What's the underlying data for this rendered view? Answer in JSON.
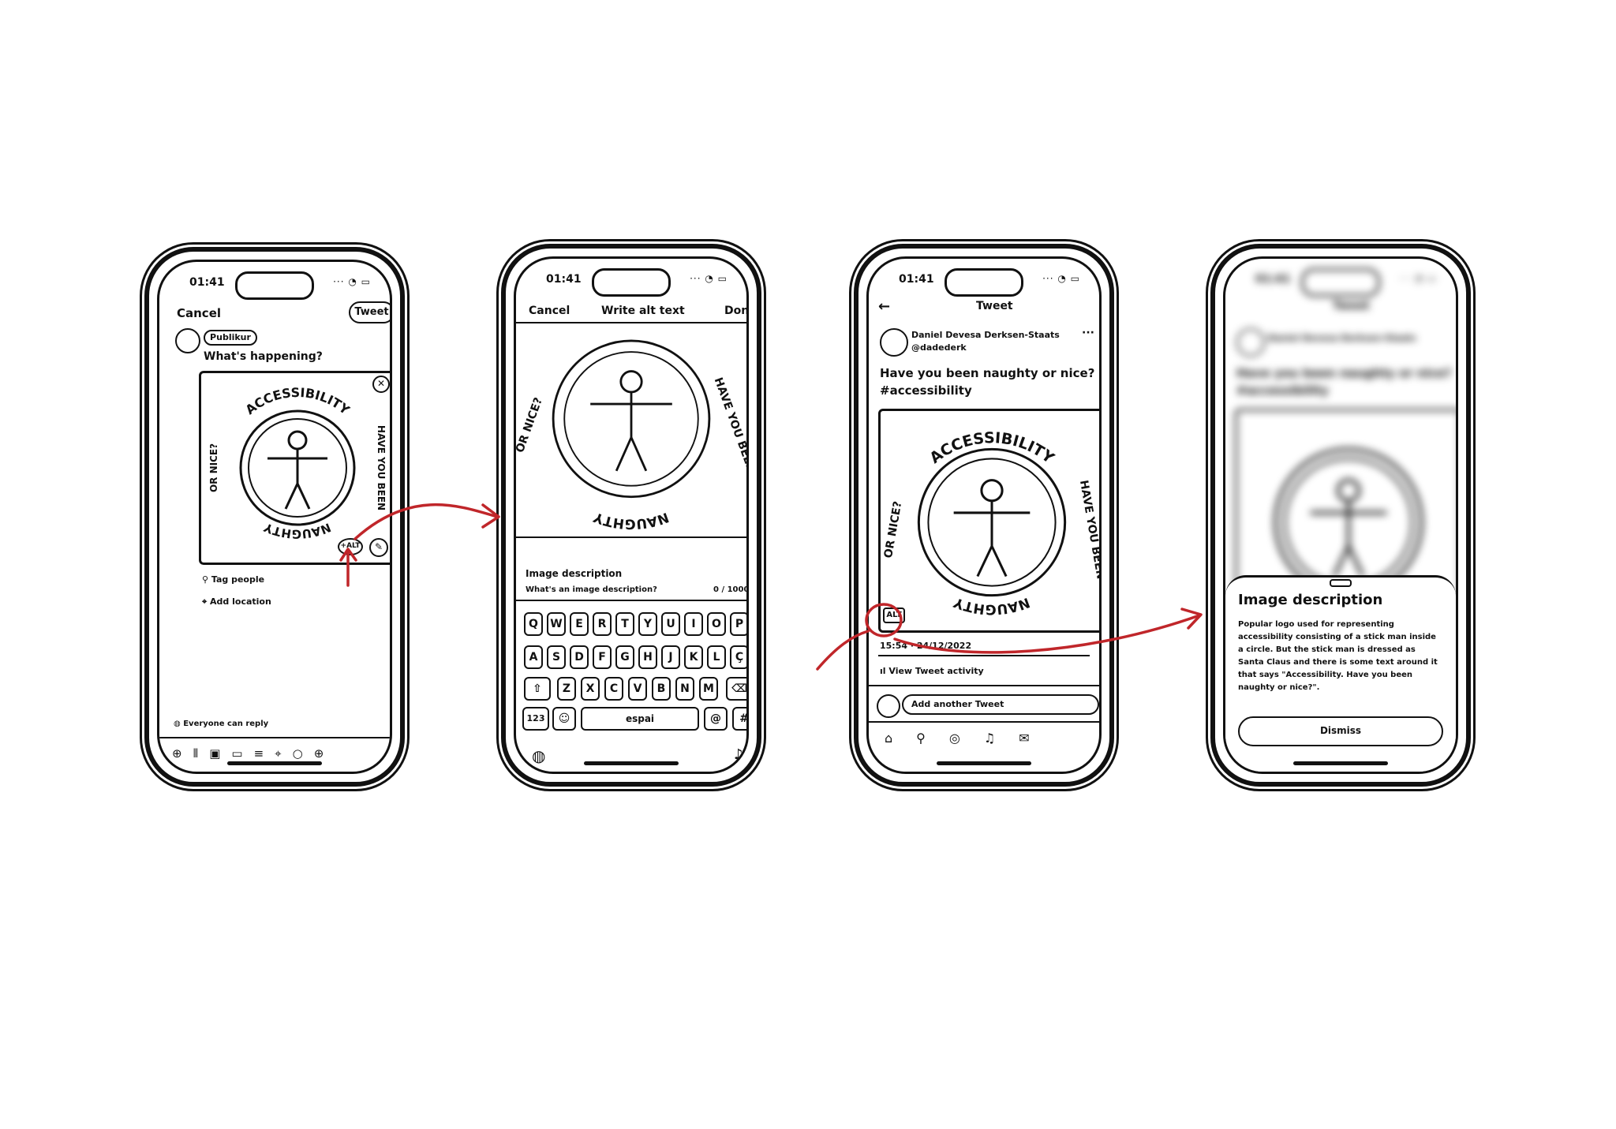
{
  "screen1": {
    "time": "01:41",
    "status": "... ",
    "cancel": "Cancel",
    "tweet": "Tweet",
    "audience": "Publikur",
    "prompt": "What's happening?",
    "alt_badge": "+ALT",
    "tag_people": "Tag people",
    "add_location": "Add location",
    "reply_setting": "Everyone can reply"
  },
  "screen2": {
    "time": "01:41",
    "cancel": "Cancel",
    "title": "Write alt text",
    "done": "Done",
    "desc_label": "Image description",
    "desc_placeholder": "What's an image description?",
    "counter": "0 / 1000",
    "keys_row1": [
      "Q",
      "W",
      "E",
      "R",
      "T",
      "Y",
      "U",
      "I",
      "O",
      "P"
    ],
    "keys_row2": [
      "A",
      "S",
      "D",
      "F",
      "G",
      "H",
      "J",
      "K",
      "L",
      "Ç"
    ],
    "keys_row3": [
      "Z",
      "X",
      "C",
      "V",
      "B",
      "N",
      "M"
    ],
    "key_123": "123",
    "key_space": "espai",
    "key_at": "@",
    "key_hash": "#"
  },
  "screen3": {
    "time": "01:41",
    "title": "Tweet",
    "author_name": "Daniel Devesa Derksen-Staats",
    "author_handle": "@dadederk",
    "body_line1": "Have you been naughty or nice?",
    "body_line2": "#accessibility",
    "alt_badge": "ALT",
    "timestamp": "15:54 · 24/12/2022",
    "activity": "View Tweet activity",
    "reply_placeholder": "Add another Tweet"
  },
  "screen4": {
    "time": "01:41",
    "sheet_title": "Image description",
    "sheet_body": "Popular logo used for representing accessibility consisting of a stick man inside a circle. But the stick man is dressed as Santa Claus and there is some text around it that says \"Accessibility. Have you been naughty or nice?\".",
    "dismiss": "Dismiss"
  },
  "badge_text": {
    "top": "ACCESSIBILITY",
    "right": "HAVE YOU BEEN",
    "bottom": "NAUGHTY",
    "left": "OR NICE?"
  },
  "colors": {
    "ink": "#111111",
    "arrow": "#c0262a",
    "paper": "#ffffff"
  }
}
